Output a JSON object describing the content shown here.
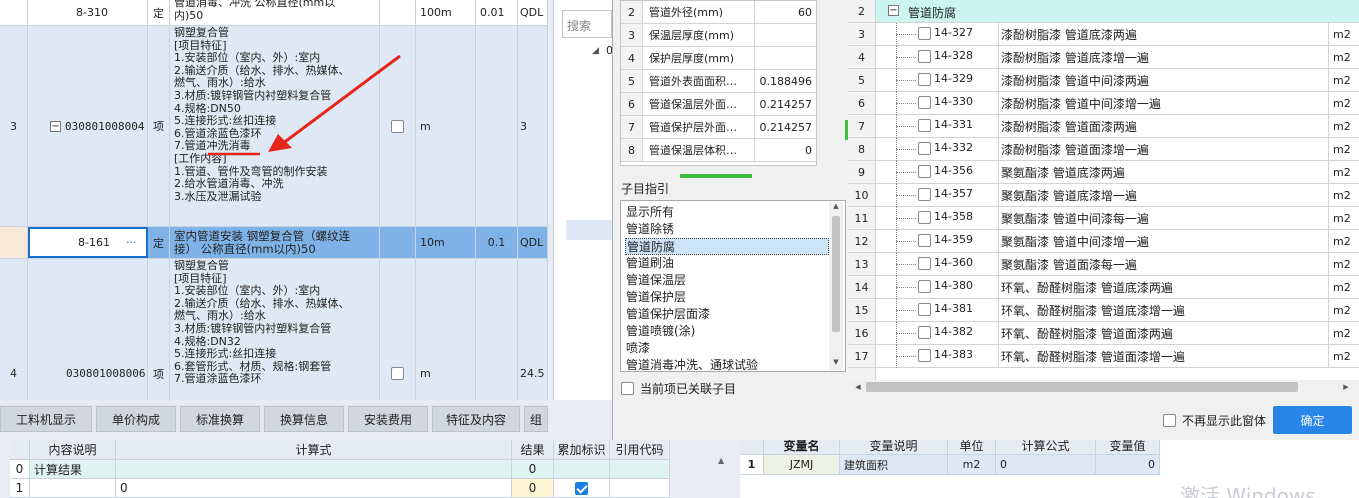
{
  "left_table": {
    "top_row": {
      "code": "8-310",
      "type": "定",
      "desc_lines": [
        "管道消毒、冲洗 公称直径(mm以",
        "内)50"
      ],
      "unit": "100m",
      "qty": "0.01",
      "extra": "QDL"
    },
    "row3": {
      "index": "3",
      "code": "030801008004",
      "type": "项",
      "desc_lines": [
        "钢塑复合管",
        "[项目特征]",
        "1.安装部位（室内、外）:室内",
        "2.输送介质（给水、排水、热媒体、",
        "燃气、雨水）:给水",
        "3.材质:镀锌钢管内衬塑料复合管",
        "4.规格:DN50",
        "5.连接形式:丝扣连接",
        "6.管道涂蓝色漆环",
        "7.管道冲洗消毒",
        "[工作内容]",
        "1.管道、管件及弯管的制作安装",
        "2.给水管道消毒、冲洗",
        "3.水压及泄漏试验"
      ],
      "unit": "m",
      "qty": "3"
    },
    "sub_row": {
      "code": "8-161",
      "dots": "···",
      "type": "定",
      "desc_lines": [
        "室内管道安装 钢塑复合管（螺纹连",
        "接） 公称直径(mm以内)50"
      ],
      "unit": "10m",
      "qty": "0.1",
      "extra": "QDL"
    },
    "row4": {
      "index": "4",
      "code": "030801008006",
      "type": "项",
      "desc_lines": [
        "钢塑复合管",
        "[项目特征]",
        "1.安装部位（室内、外）:室内",
        "2.输送介质（给水、排水、热媒体、",
        "燃气、雨水）:给水",
        "3.材质:镀锌钢管内衬塑料复合管",
        "4.规格:DN32",
        "5.连接形式:丝扣连接",
        "6.套管形式、材质、规格:钢套管",
        "7.管道涂蓝色漆环"
      ],
      "unit": "m",
      "qty": "24.5"
    }
  },
  "tabs": [
    "工料机显示",
    "单价构成",
    "标准换算",
    "换算信息",
    "安装费用",
    "特征及内容",
    "组"
  ],
  "calc_table": {
    "headers": [
      "内容说明",
      "计算式",
      "结果",
      "累加标识",
      "引用代码"
    ],
    "rows": [
      {
        "index": "0",
        "desc": "计算结果",
        "formula": "",
        "result": "0",
        "accum": false
      },
      {
        "index": "1",
        "desc": "",
        "formula": "0",
        "result": "0",
        "accum": true
      }
    ]
  },
  "mid_panel": {
    "search_placeholder": "搜索",
    "tree_fragment": "0"
  },
  "param_table": [
    {
      "index": "2",
      "name": "管道外径(mm)",
      "value": "60"
    },
    {
      "index": "3",
      "name": "保温层厚度(mm)",
      "value": ""
    },
    {
      "index": "4",
      "name": "保护层厚度(mm)",
      "value": ""
    },
    {
      "index": "5",
      "name": "管道外表面面积…",
      "value": "0.188496"
    },
    {
      "index": "6",
      "name": "管道保温层外面…",
      "value": "0.214257"
    },
    {
      "index": "7",
      "name": "管道保护层外面…",
      "value": "0.214257"
    },
    {
      "index": "8",
      "name": "管道保温层体积…",
      "value": "0"
    }
  ],
  "guide": {
    "title": "子目指引",
    "items": [
      "显示所有",
      "管道除锈",
      "管道防腐",
      "管道刷油",
      "管道保温层",
      "管道保护层",
      "管道保护层面漆",
      "管道喷镀(涂)",
      "喷漆",
      "管道消毒冲洗、通球试验"
    ],
    "selected_index": 2,
    "only_associated_label": "当前项已关联子目"
  },
  "right_table": {
    "group_row": {
      "index": "2",
      "label": "管道防腐"
    },
    "rows": [
      {
        "index": "3",
        "code": "14-327",
        "name": "漆酚树脂漆 管道底漆两遍",
        "unit": "m2"
      },
      {
        "index": "4",
        "code": "14-328",
        "name": "漆酚树脂漆 管道底漆增一遍",
        "unit": "m2"
      },
      {
        "index": "5",
        "code": "14-329",
        "name": "漆酚树脂漆 管道中间漆两遍",
        "unit": "m2"
      },
      {
        "index": "6",
        "code": "14-330",
        "name": "漆酚树脂漆 管道中间漆增一遍",
        "unit": "m2"
      },
      {
        "index": "7",
        "code": "14-331",
        "name": "漆酚树脂漆 管道面漆两遍",
        "unit": "m2"
      },
      {
        "index": "8",
        "code": "14-332",
        "name": "漆酚树脂漆 管道面漆增一遍",
        "unit": "m2"
      },
      {
        "index": "9",
        "code": "14-356",
        "name": "聚氨酯漆 管道底漆两遍",
        "unit": "m2"
      },
      {
        "index": "10",
        "code": "14-357",
        "name": "聚氨酯漆 管道底漆增一遍",
        "unit": "m2"
      },
      {
        "index": "11",
        "code": "14-358",
        "name": "聚氨酯漆 管道中间漆每一遍",
        "unit": "m2"
      },
      {
        "index": "12",
        "code": "14-359",
        "name": "聚氨酯漆 管道中间漆增一遍",
        "unit": "m2"
      },
      {
        "index": "13",
        "code": "14-360",
        "name": "聚氨酯漆 管道面漆每一遍",
        "unit": "m2"
      },
      {
        "index": "14",
        "code": "14-380",
        "name": "环氧、酚醛树脂漆 管道底漆两遍",
        "unit": "m2"
      },
      {
        "index": "15",
        "code": "14-381",
        "name": "环氧、酚醛树脂漆 管道底漆增一遍",
        "unit": "m2"
      },
      {
        "index": "16",
        "code": "14-382",
        "name": "环氧、酚醛树脂漆 管道面漆两遍",
        "unit": "m2"
      },
      {
        "index": "17",
        "code": "14-383",
        "name": "环氧、酚醛树脂漆 管道面漆增一遍",
        "unit": "m2"
      }
    ]
  },
  "footer": {
    "no_show_label": "不再显示此窗体",
    "ok_label": "确定"
  },
  "bottom_right": {
    "headers": [
      "变量名",
      "变量说明",
      "单位",
      "计算公式",
      "变量值"
    ],
    "row": {
      "index": "1",
      "var": "JZMJ",
      "desc": "建筑面积",
      "unit": "m2",
      "formula": "0",
      "value": "0"
    }
  },
  "watermark": "激活 Windows",
  "colors": {
    "accent": "#2a85e8",
    "selected_row": "#7fb3e8",
    "light_row": "#dfe9f6",
    "group_row": "#cdf5f0",
    "annotation": "#e8251a"
  }
}
